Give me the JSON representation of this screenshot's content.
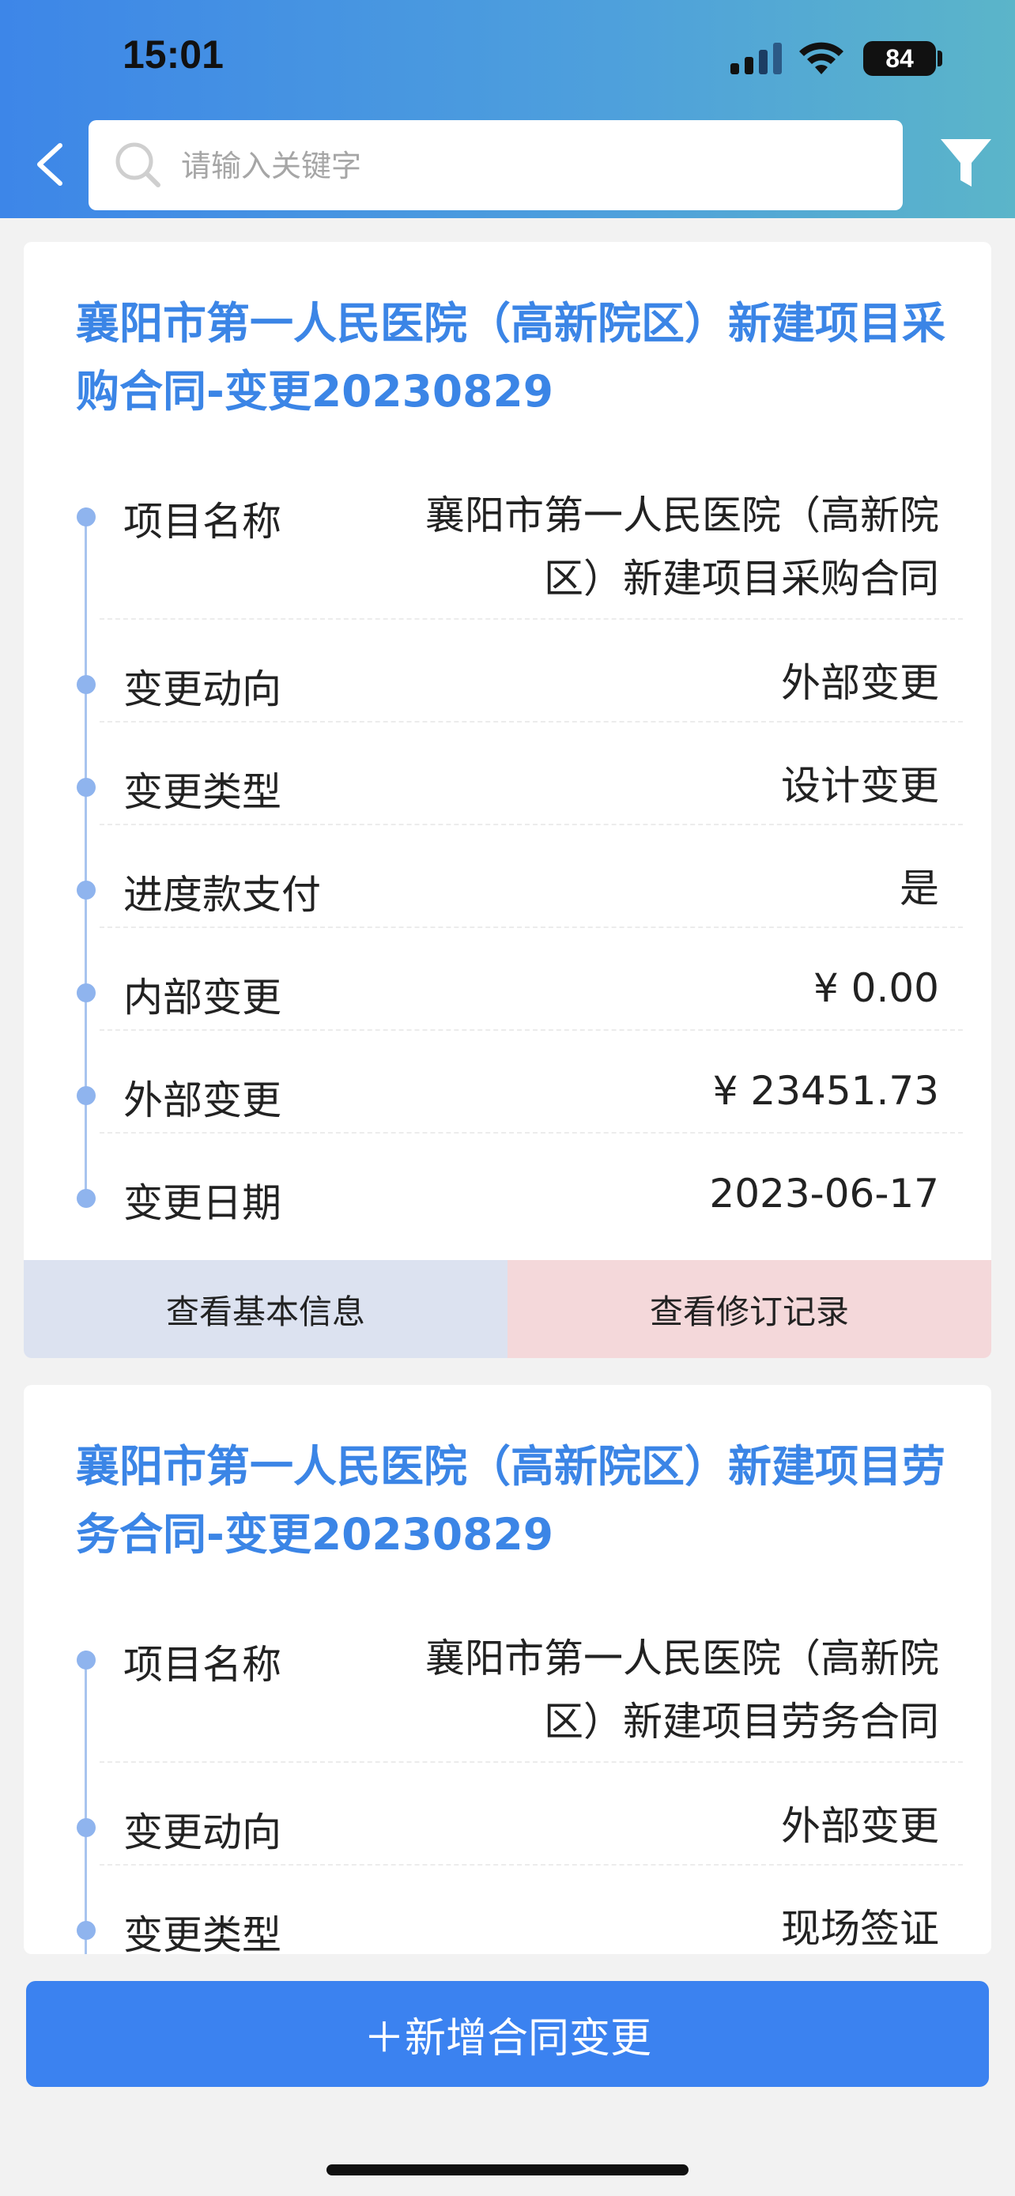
{
  "status_bar": {
    "time": "15:01",
    "battery": "84"
  },
  "search": {
    "placeholder": "请输入关键字"
  },
  "cards": [
    {
      "title": "襄阳市第一人民医院（高新院区）新建项目采购合同-变更20230829",
      "fields": [
        {
          "label": "项目名称",
          "value": "襄阳市第一人民医院（高新院区）新建项目采购合同"
        },
        {
          "label": "变更动向",
          "value": "外部变更"
        },
        {
          "label": "变更类型",
          "value": "设计变更"
        },
        {
          "label": "进度款支付",
          "value": "是"
        },
        {
          "label": "内部变更",
          "value": "¥ 0.00"
        },
        {
          "label": "外部变更",
          "value": "¥ 23451.73"
        },
        {
          "label": "变更日期",
          "value": "2023-06-17"
        }
      ],
      "btn_basic": "查看基本信息",
      "btn_history": "查看修订记录"
    },
    {
      "title": "襄阳市第一人民医院（高新院区）新建项目劳务合同-变更20230829",
      "fields": [
        {
          "label": "项目名称",
          "value": "襄阳市第一人民医院（高新院区）新建项目劳务合同"
        },
        {
          "label": "变更动向",
          "value": "外部变更"
        },
        {
          "label": "变更类型",
          "value": "现场签证"
        }
      ]
    }
  ],
  "add_button": "＋新增合同变更",
  "colors": {
    "accent": "#3b82f0",
    "title": "#3b85e6"
  }
}
